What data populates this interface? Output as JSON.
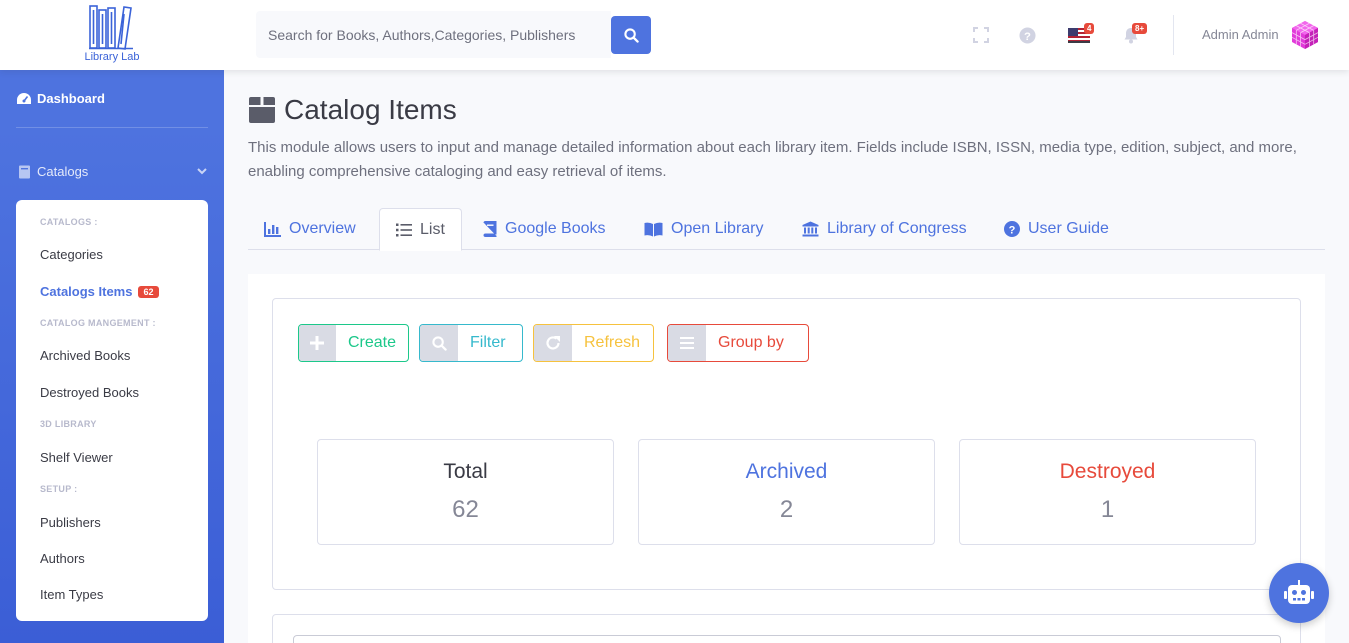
{
  "app": {
    "logo_text": "Library Lab"
  },
  "search": {
    "placeholder": "Search for Books, Authors,Categories, Publishers"
  },
  "topbar": {
    "flag_badge": "4",
    "alerts_badge": "8+",
    "user_name": "Admin Admin"
  },
  "sidebar": {
    "dashboard": "Dashboard",
    "catalogs": "Catalogs",
    "submenu": {
      "head_catalogs": "CATALOGS :",
      "categories": "Categories",
      "catalog_items": "Catalogs Items",
      "catalog_items_count": "62",
      "head_management": "CATALOG MANGEMENT :",
      "archived_books": "Archived Books",
      "destroyed_books": "Destroyed Books",
      "head_3d": "3D LIBRARY",
      "shelf_viewer": "Shelf Viewer",
      "head_setup": "SETUP :",
      "publishers": "Publishers",
      "authors": "Authors",
      "item_types": "Item Types"
    }
  },
  "page": {
    "title": "Catalog Items",
    "description": "This module allows users to input and manage detailed information about each library item. Fields include ISBN, ISSN, media type, edition, subject, and more, enabling comprehensive cataloging and easy retrieval of items."
  },
  "tabs": [
    {
      "label": "Overview"
    },
    {
      "label": "List"
    },
    {
      "label": "Google Books"
    },
    {
      "label": "Open Library"
    },
    {
      "label": "Library of Congress"
    },
    {
      "label": "User Guide"
    }
  ],
  "actions": {
    "create": "Create",
    "filter": "Filter",
    "refresh": "Refresh",
    "group_by": "Group by"
  },
  "stats": [
    {
      "title": "Total",
      "value": "62"
    },
    {
      "title": "Archived",
      "value": "2"
    },
    {
      "title": "Destroyed",
      "value": "1"
    }
  ],
  "colors": {
    "primary": "#4e73df",
    "success": "#1cc88a",
    "info": "#36b9cc",
    "warning": "#f6c23e",
    "danger": "#e74a3b"
  }
}
